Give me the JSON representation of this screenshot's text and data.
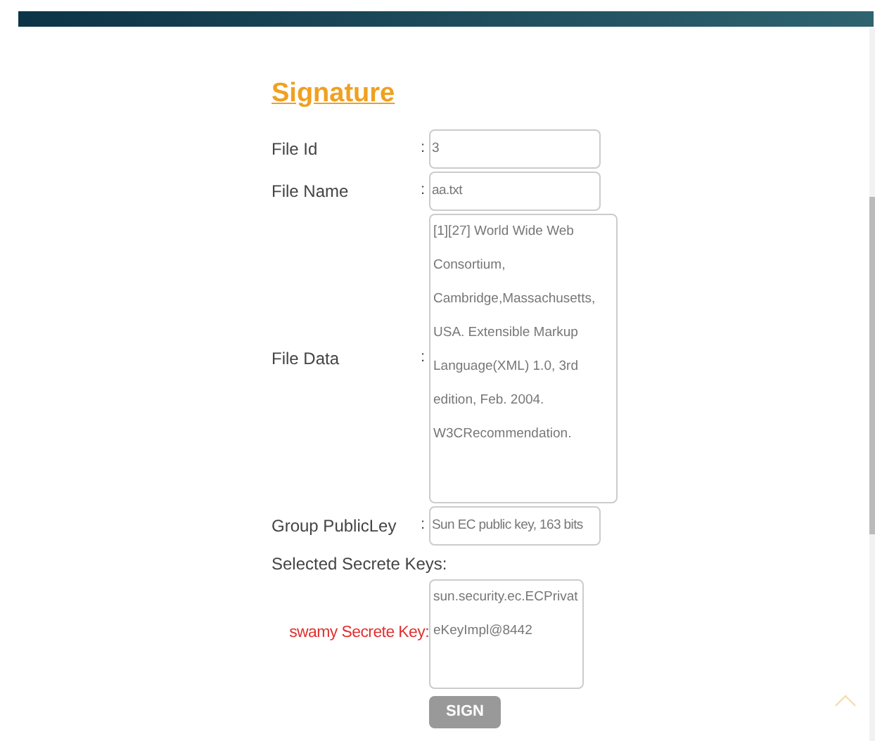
{
  "title": "Signature",
  "fields": [
    {
      "label": "File Id",
      "separator": ":",
      "kind": "input",
      "value": "3"
    },
    {
      "label": "File Name",
      "separator": ":",
      "kind": "input",
      "value": "aa.txt"
    },
    {
      "label": "File Data",
      "separator": ":",
      "kind": "textarea",
      "value": "[1][27] World Wide Web Consortium, Cambridge,Massachusetts, USA. Extensible Markup Language(XML) 1.0, 3rd edition, Feb. 2004. W3CRecommendation."
    },
    {
      "label": "Group PublicLey",
      "separator": ":",
      "kind": "input",
      "value": "Sun EC public key, 163 bits"
    }
  ],
  "section_label": "Selected Secrete Keys:",
  "secret_key": {
    "label": "swamy Secrete Key:",
    "value": "sun.security.ec.ECPrivateKeyImpl@8442"
  },
  "button": "SIGN"
}
